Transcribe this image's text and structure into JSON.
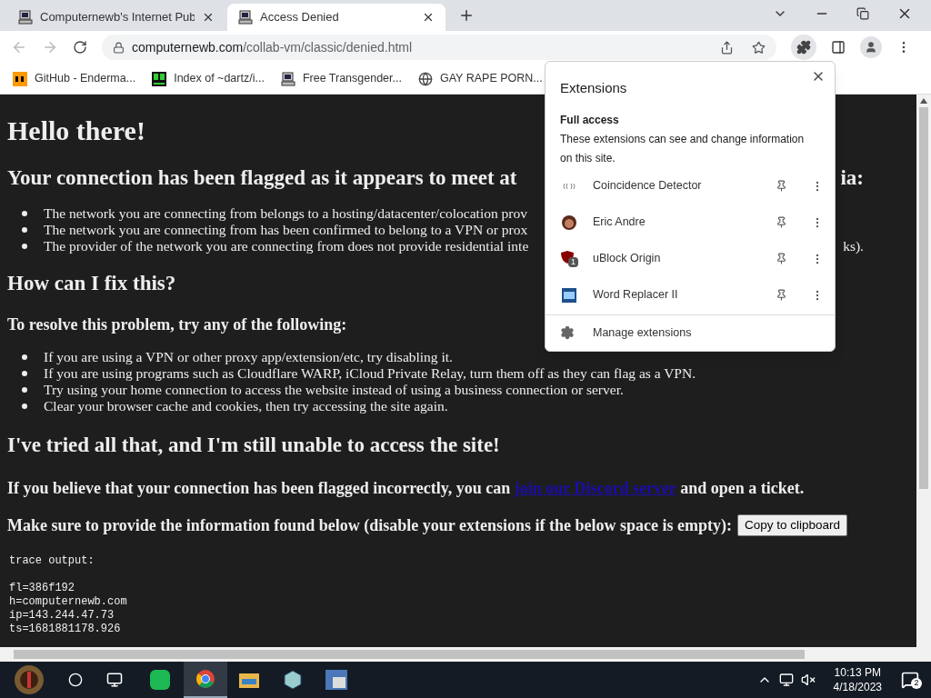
{
  "tabs": [
    {
      "title": "Computernewb's Internet Pub",
      "selected": false
    },
    {
      "title": "Access Denied",
      "selected": true
    }
  ],
  "address": {
    "domain": "computernewb.com",
    "path": "/collab-vm/classic/denied.html"
  },
  "bookmarks": [
    {
      "title": "GitHub - Enderma..."
    },
    {
      "title": "Index of ~dartz/i..."
    },
    {
      "title": "Free Transgender..."
    },
    {
      "title": "GAY RAPE PORN..."
    }
  ],
  "page": {
    "title": "Hello there!",
    "flag_heading": "Your connection has been flagged as it appears to meet at",
    "flag_heading_tail": "ia:",
    "reasons": [
      {
        "text": "The network you are connecting from belongs to a hosting/datacenter/colocation prov"
      },
      {
        "text": "The network you are connecting from has been confirmed to belong to a VPN or prox"
      },
      {
        "text": "The provider of the network you are connecting from does not provide residential inte",
        "tail": "ks)."
      }
    ],
    "fix_heading": "How can I fix this?",
    "resolve_heading": "To resolve this problem, try any of the following:",
    "fixes": [
      "If you are using a VPN or other proxy app/extension/etc, try disabling it.",
      "If you are using programs such as Cloudflare WARP, iCloud Private Relay, turn them off as they can flag as a VPN.",
      "Try using your home connection to access the website instead of using a business connection or server.",
      "Clear your browser cache and cookies, then try accessing the site again."
    ],
    "still_heading": "I've tried all that, and I'm still unable to access the site!",
    "ticket_before": "If you believe that your connection has been flagged incorrectly, you can",
    "ticket_link": "join our Discord server",
    "ticket_after": "and open a ticket.",
    "provide_text": "Make sure to provide the information found below (disable your extensions if the below space is empty):",
    "copy_button": "Copy to clipboard",
    "trace_label": "trace output:",
    "trace": [
      "fl=386f192",
      "h=computernewb.com",
      "ip=143.244.47.73",
      "ts=1681881178.926"
    ]
  },
  "extensions_popup": {
    "title": "Extensions",
    "section": "Full access",
    "description": "These extensions can see and change information on this site.",
    "items": [
      {
        "name": "Coincidence Detector"
      },
      {
        "name": "Eric Andre"
      },
      {
        "name": "uBlock Origin",
        "badge": "1"
      },
      {
        "name": "Word Replacer II"
      }
    ],
    "manage": "Manage extensions"
  },
  "taskbar": {
    "time": "10:13 PM",
    "date": "4/18/2023",
    "notifications": "2"
  }
}
